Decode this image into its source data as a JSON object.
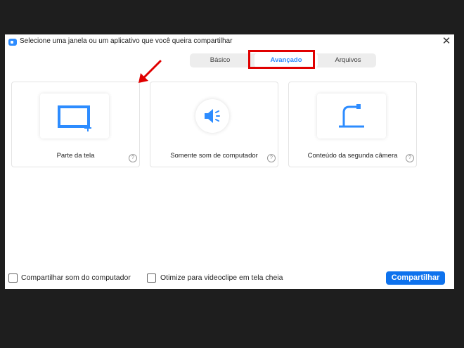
{
  "window": {
    "title": "Selecione uma janela ou um aplicativo que você queira compartilhar",
    "close_glyph": "✕",
    "icons": {
      "app": "zoom-camera-icon",
      "close": "close-icon"
    }
  },
  "tabs": [
    {
      "label": "Básico",
      "selected": false
    },
    {
      "label": "Avançado",
      "selected": true
    },
    {
      "label": "Arquivos",
      "selected": false
    }
  ],
  "annotation": {
    "highlight_color": "#e00000",
    "arrow_color": "#e00000"
  },
  "options": [
    {
      "label": "Parte da tela",
      "icon": "screen-portion-icon",
      "help": "?"
    },
    {
      "label": "Somente som de computador",
      "icon": "speaker-icon",
      "help": "?"
    },
    {
      "label": "Conteúdo da segunda câmera",
      "icon": "document-camera-icon",
      "help": "?"
    }
  ],
  "footer": {
    "share_sound_label": "Compartilhar som do computador",
    "share_sound_checked": false,
    "optimize_video_label": "Otimize para videoclipe em tela cheia",
    "optimize_video_checked": false,
    "share_button_label": "Compartilhar"
  },
  "colors": {
    "accent": "#2d8cff",
    "button": "#0e72ed",
    "background": "#1e1e1e"
  }
}
